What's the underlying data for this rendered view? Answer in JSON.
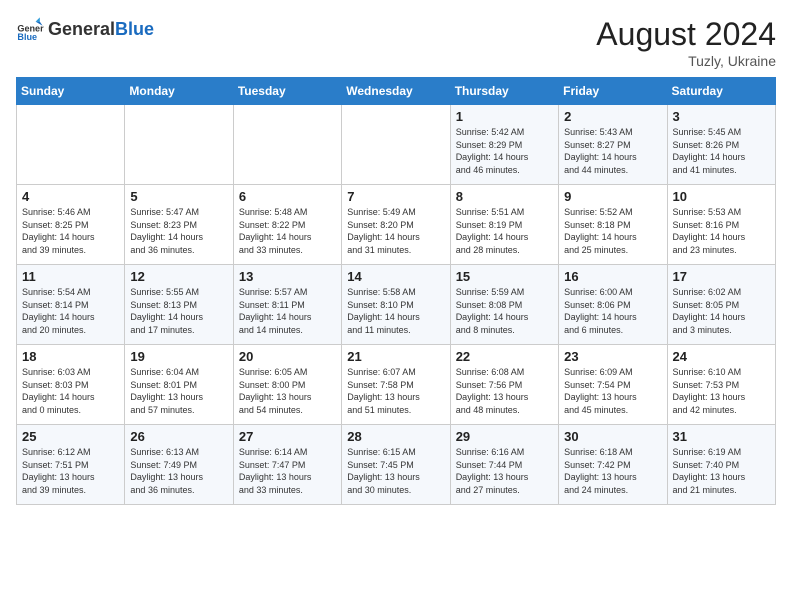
{
  "header": {
    "logo_general": "General",
    "logo_blue": "Blue",
    "month_year": "August 2024",
    "location": "Tuzly, Ukraine"
  },
  "days_of_week": [
    "Sunday",
    "Monday",
    "Tuesday",
    "Wednesday",
    "Thursday",
    "Friday",
    "Saturday"
  ],
  "weeks": [
    [
      {
        "day": "",
        "info": ""
      },
      {
        "day": "",
        "info": ""
      },
      {
        "day": "",
        "info": ""
      },
      {
        "day": "",
        "info": ""
      },
      {
        "day": "1",
        "info": "Sunrise: 5:42 AM\nSunset: 8:29 PM\nDaylight: 14 hours\nand 46 minutes."
      },
      {
        "day": "2",
        "info": "Sunrise: 5:43 AM\nSunset: 8:27 PM\nDaylight: 14 hours\nand 44 minutes."
      },
      {
        "day": "3",
        "info": "Sunrise: 5:45 AM\nSunset: 8:26 PM\nDaylight: 14 hours\nand 41 minutes."
      }
    ],
    [
      {
        "day": "4",
        "info": "Sunrise: 5:46 AM\nSunset: 8:25 PM\nDaylight: 14 hours\nand 39 minutes."
      },
      {
        "day": "5",
        "info": "Sunrise: 5:47 AM\nSunset: 8:23 PM\nDaylight: 14 hours\nand 36 minutes."
      },
      {
        "day": "6",
        "info": "Sunrise: 5:48 AM\nSunset: 8:22 PM\nDaylight: 14 hours\nand 33 minutes."
      },
      {
        "day": "7",
        "info": "Sunrise: 5:49 AM\nSunset: 8:20 PM\nDaylight: 14 hours\nand 31 minutes."
      },
      {
        "day": "8",
        "info": "Sunrise: 5:51 AM\nSunset: 8:19 PM\nDaylight: 14 hours\nand 28 minutes."
      },
      {
        "day": "9",
        "info": "Sunrise: 5:52 AM\nSunset: 8:18 PM\nDaylight: 14 hours\nand 25 minutes."
      },
      {
        "day": "10",
        "info": "Sunrise: 5:53 AM\nSunset: 8:16 PM\nDaylight: 14 hours\nand 23 minutes."
      }
    ],
    [
      {
        "day": "11",
        "info": "Sunrise: 5:54 AM\nSunset: 8:14 PM\nDaylight: 14 hours\nand 20 minutes."
      },
      {
        "day": "12",
        "info": "Sunrise: 5:55 AM\nSunset: 8:13 PM\nDaylight: 14 hours\nand 17 minutes."
      },
      {
        "day": "13",
        "info": "Sunrise: 5:57 AM\nSunset: 8:11 PM\nDaylight: 14 hours\nand 14 minutes."
      },
      {
        "day": "14",
        "info": "Sunrise: 5:58 AM\nSunset: 8:10 PM\nDaylight: 14 hours\nand 11 minutes."
      },
      {
        "day": "15",
        "info": "Sunrise: 5:59 AM\nSunset: 8:08 PM\nDaylight: 14 hours\nand 8 minutes."
      },
      {
        "day": "16",
        "info": "Sunrise: 6:00 AM\nSunset: 8:06 PM\nDaylight: 14 hours\nand 6 minutes."
      },
      {
        "day": "17",
        "info": "Sunrise: 6:02 AM\nSunset: 8:05 PM\nDaylight: 14 hours\nand 3 minutes."
      }
    ],
    [
      {
        "day": "18",
        "info": "Sunrise: 6:03 AM\nSunset: 8:03 PM\nDaylight: 14 hours\nand 0 minutes."
      },
      {
        "day": "19",
        "info": "Sunrise: 6:04 AM\nSunset: 8:01 PM\nDaylight: 13 hours\nand 57 minutes."
      },
      {
        "day": "20",
        "info": "Sunrise: 6:05 AM\nSunset: 8:00 PM\nDaylight: 13 hours\nand 54 minutes."
      },
      {
        "day": "21",
        "info": "Sunrise: 6:07 AM\nSunset: 7:58 PM\nDaylight: 13 hours\nand 51 minutes."
      },
      {
        "day": "22",
        "info": "Sunrise: 6:08 AM\nSunset: 7:56 PM\nDaylight: 13 hours\nand 48 minutes."
      },
      {
        "day": "23",
        "info": "Sunrise: 6:09 AM\nSunset: 7:54 PM\nDaylight: 13 hours\nand 45 minutes."
      },
      {
        "day": "24",
        "info": "Sunrise: 6:10 AM\nSunset: 7:53 PM\nDaylight: 13 hours\nand 42 minutes."
      }
    ],
    [
      {
        "day": "25",
        "info": "Sunrise: 6:12 AM\nSunset: 7:51 PM\nDaylight: 13 hours\nand 39 minutes."
      },
      {
        "day": "26",
        "info": "Sunrise: 6:13 AM\nSunset: 7:49 PM\nDaylight: 13 hours\nand 36 minutes."
      },
      {
        "day": "27",
        "info": "Sunrise: 6:14 AM\nSunset: 7:47 PM\nDaylight: 13 hours\nand 33 minutes."
      },
      {
        "day": "28",
        "info": "Sunrise: 6:15 AM\nSunset: 7:45 PM\nDaylight: 13 hours\nand 30 minutes."
      },
      {
        "day": "29",
        "info": "Sunrise: 6:16 AM\nSunset: 7:44 PM\nDaylight: 13 hours\nand 27 minutes."
      },
      {
        "day": "30",
        "info": "Sunrise: 6:18 AM\nSunset: 7:42 PM\nDaylight: 13 hours\nand 24 minutes."
      },
      {
        "day": "31",
        "info": "Sunrise: 6:19 AM\nSunset: 7:40 PM\nDaylight: 13 hours\nand 21 minutes."
      }
    ]
  ]
}
